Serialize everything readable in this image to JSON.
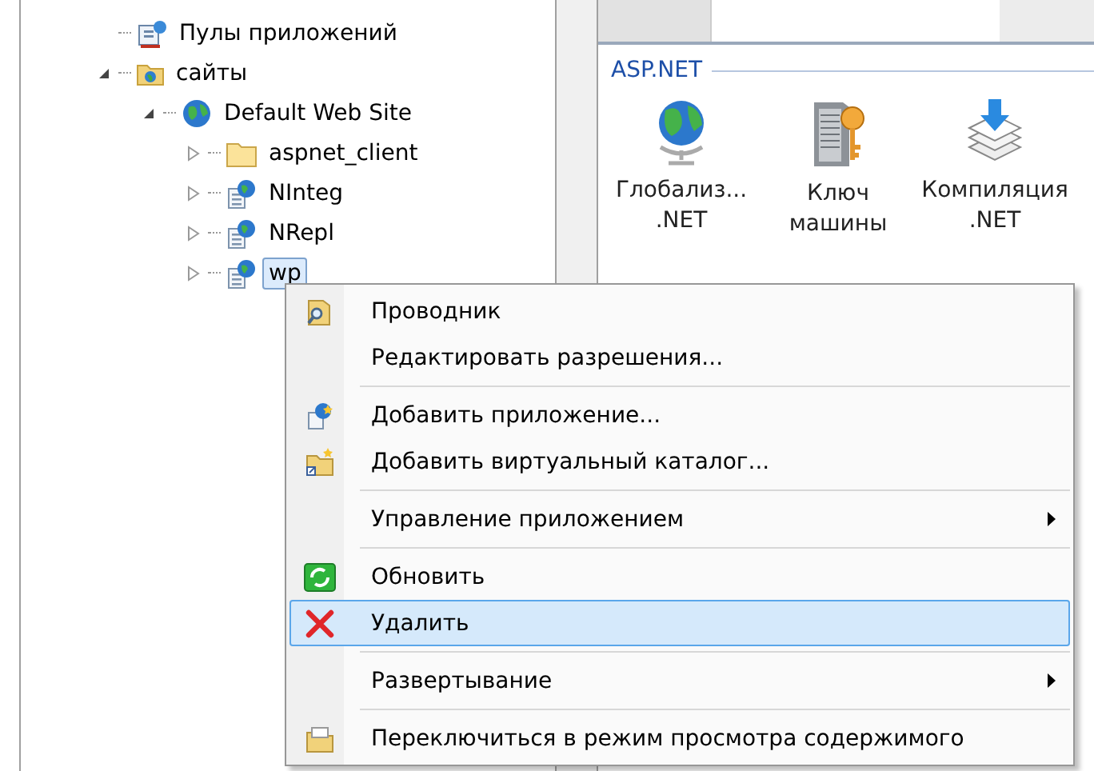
{
  "tree": [
    {
      "label": "Пулы приложений",
      "kind": "pool",
      "selected": false
    },
    {
      "label": "сайты",
      "kind": "sites",
      "expanded": true,
      "selected": false,
      "children": [
        {
          "label": "Default Web Site",
          "kind": "website",
          "expanded": true,
          "selected": false,
          "children": [
            {
              "label": "aspnet_client",
              "kind": "folder",
              "expanded": false,
              "selected": false
            },
            {
              "label": "NInteg",
              "kind": "app",
              "expanded": false,
              "selected": false
            },
            {
              "label": "NRepl",
              "kind": "app",
              "expanded": false,
              "selected": false
            },
            {
              "label": "wp",
              "kind": "app",
              "expanded": false,
              "selected": true
            }
          ]
        }
      ]
    }
  ],
  "features": {
    "group": "ASP.NET",
    "items": [
      {
        "kind": "globe",
        "lines": [
          "Глобализ...",
          ".NET"
        ]
      },
      {
        "kind": "key",
        "lines": [
          "Ключ",
          "машины"
        ]
      },
      {
        "kind": "compile",
        "lines": [
          "Компиляция",
          ".NET"
        ]
      }
    ]
  },
  "context_menu": [
    {
      "kind": "item",
      "label": "Проводник",
      "submenu": false,
      "selected": false
    },
    {
      "kind": "item",
      "label": "Редактировать разрешения...",
      "submenu": false,
      "selected": false
    },
    {
      "kind": "separator"
    },
    {
      "kind": "item",
      "label": "Добавить приложение...",
      "submenu": false,
      "selected": false
    },
    {
      "kind": "item",
      "label": "Добавить виртуальный каталог...",
      "submenu": false,
      "selected": false
    },
    {
      "kind": "separator"
    },
    {
      "kind": "item",
      "label": "Управление приложением",
      "submenu": true,
      "selected": false
    },
    {
      "kind": "separator"
    },
    {
      "kind": "item",
      "label": "Обновить",
      "submenu": false,
      "selected": false
    },
    {
      "kind": "item",
      "label": "Удалить",
      "submenu": false,
      "selected": true
    },
    {
      "kind": "separator"
    },
    {
      "kind": "item",
      "label": "Развертывание",
      "submenu": true,
      "selected": false
    },
    {
      "kind": "separator"
    },
    {
      "kind": "item",
      "label": "Переключиться в режим просмотра содержимого",
      "submenu": false,
      "selected": false
    }
  ]
}
